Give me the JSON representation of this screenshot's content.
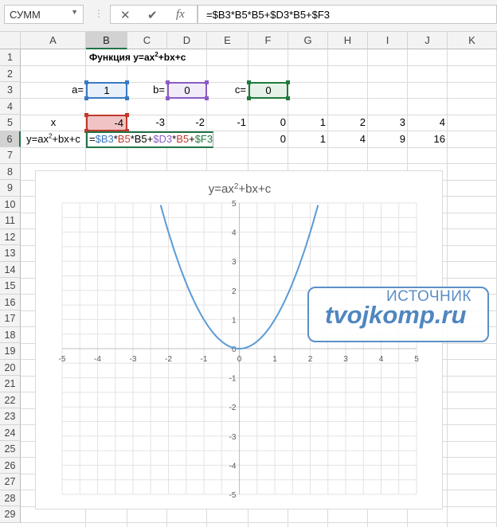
{
  "formula_bar": {
    "name_box": "СУММ",
    "cancel": "✕",
    "enter": "✔",
    "fx": "fx",
    "formula": "=$B3*B5*B5+$D3*B5+$F3"
  },
  "columns": [
    "A",
    "B",
    "C",
    "D",
    "E",
    "F",
    "G",
    "H",
    "I",
    "J",
    "K"
  ],
  "rows": [
    "1",
    "2",
    "3",
    "4",
    "5",
    "6",
    "7",
    "8",
    "9",
    "10",
    "11",
    "12",
    "13",
    "14",
    "15",
    "16",
    "17",
    "18",
    "19",
    "20",
    "21",
    "22",
    "23",
    "24",
    "25",
    "26",
    "27",
    "28",
    "29"
  ],
  "cells": {
    "title": "Функция y=ax",
    "title_sup": "2",
    "title_rest": "+bx+c",
    "a_label": "a=",
    "a_value": "1",
    "b_label": "b=",
    "b_value": "0",
    "c_label": "c=",
    "c_value": "0",
    "x_label": "x",
    "x_values": [
      "-4",
      "-3",
      "-2",
      "-1",
      "0",
      "1",
      "2",
      "3",
      "4"
    ],
    "y_label": "y=ax",
    "y_label_sup": "2",
    "y_label_rest": "+bx+c",
    "y_values": [
      "0",
      "1",
      "4",
      "9",
      "16"
    ],
    "edit_parts": [
      [
        "=",
        "#000"
      ],
      [
        "$B3",
        "#3a78c2"
      ],
      [
        "*",
        "#000"
      ],
      [
        "B5",
        "#c0392b"
      ],
      [
        "*B5+",
        "#000"
      ],
      [
        "$D3",
        "#8a5cc4"
      ],
      [
        "*",
        "#000"
      ],
      [
        "B5",
        "#c0392b"
      ],
      [
        "+",
        "#000"
      ],
      [
        "$F3",
        "#1e7a3c"
      ]
    ]
  },
  "chart_data": {
    "type": "line",
    "title": "y=ax",
    "title_sup": "2",
    "title_rest": "+bx+c",
    "coefficients": {
      "a": 1,
      "b": 0,
      "c": 0
    },
    "xlim": [
      -5,
      5
    ],
    "ylim": [
      -5,
      5
    ],
    "x_ticks": [
      "-5",
      "-4",
      "-3",
      "-2",
      "-1",
      "0",
      "1",
      "2",
      "3",
      "4",
      "5"
    ],
    "y_ticks": [
      "5",
      "4",
      "3",
      "2",
      "1",
      "0",
      "-1",
      "-2",
      "-3",
      "-4",
      "-5"
    ],
    "grid": true,
    "series_color": "#5b9bd5"
  },
  "watermark": {
    "source": "ИСТОЧНИК",
    "url": "tvojkomp.ru"
  }
}
